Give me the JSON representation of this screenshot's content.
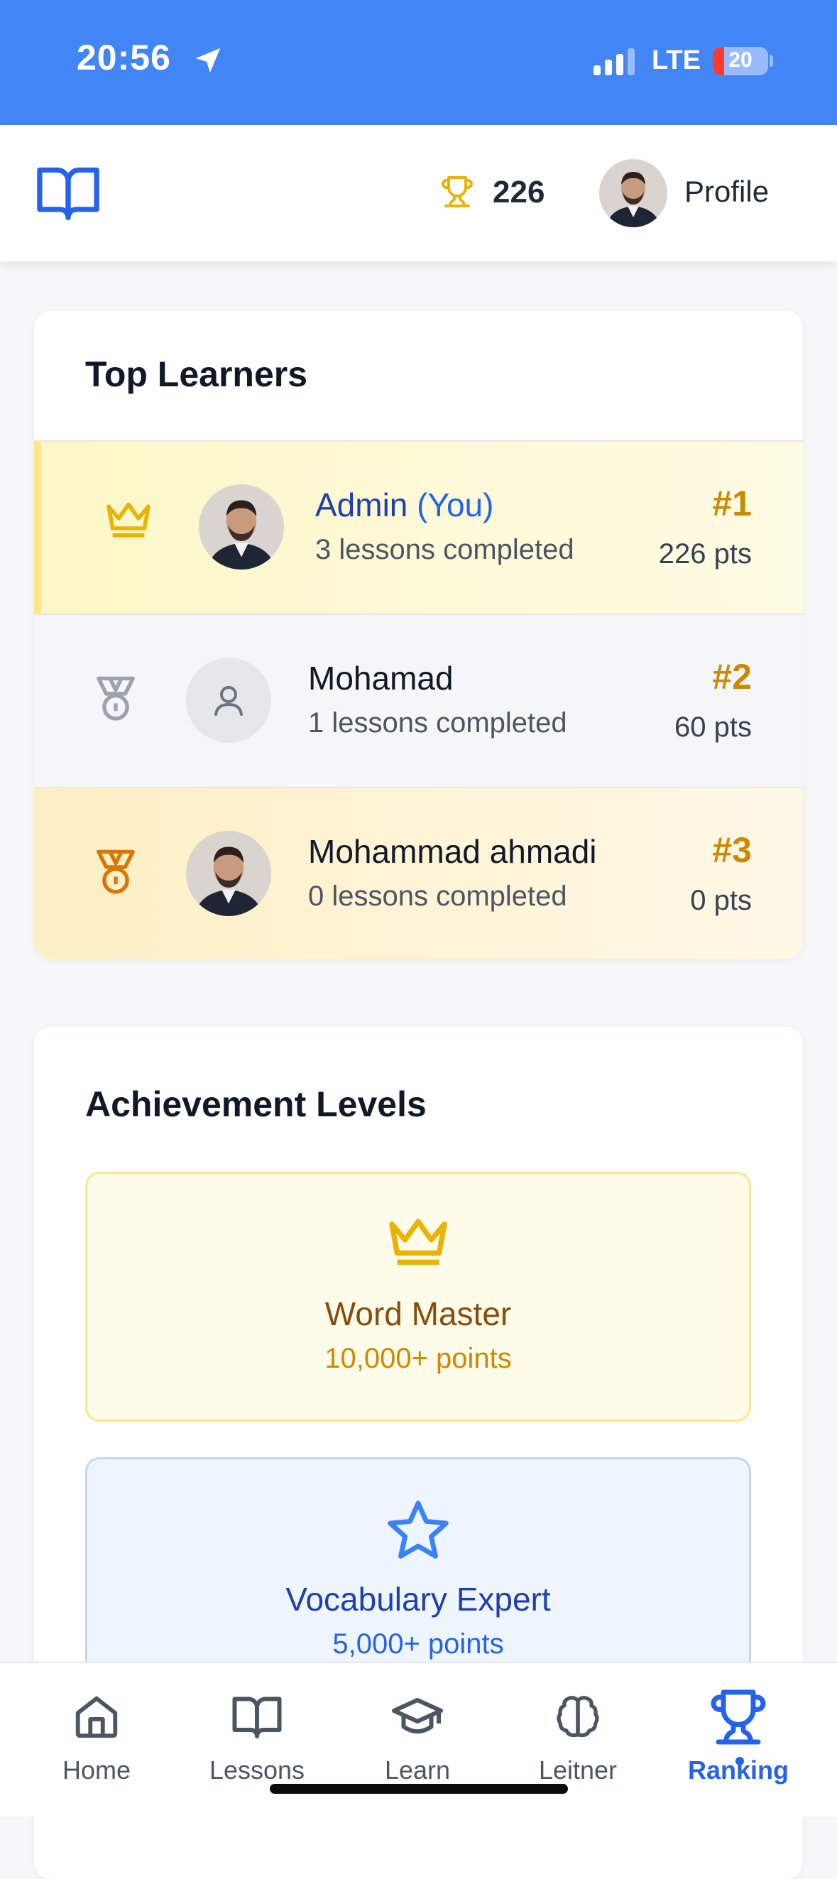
{
  "status_bar": {
    "time": "20:56",
    "network": "LTE",
    "battery": "20"
  },
  "header": {
    "points": "226",
    "profile_label": "Profile"
  },
  "top_learners": {
    "title": "Top Learners",
    "rows": [
      {
        "name": "Admin",
        "you_tag": "(You)",
        "subtitle": "3 lessons completed",
        "rank": "#1",
        "points": "226 pts"
      },
      {
        "name": "Mohamad",
        "you_tag": "",
        "subtitle": "1 lessons completed",
        "rank": "#2",
        "points": "60 pts"
      },
      {
        "name": "Mohammad ahmadi",
        "you_tag": "",
        "subtitle": "0 lessons completed",
        "rank": "#3",
        "points": "0 pts"
      }
    ]
  },
  "achievements": {
    "title": "Achievement Levels",
    "levels": [
      {
        "title": "Word Master",
        "points": "10,000+ points",
        "icon": "crown-icon"
      },
      {
        "title": "Vocabulary Expert",
        "points": "5,000+ points",
        "icon": "star-icon"
      }
    ]
  },
  "nav": {
    "items": [
      {
        "label": "Home",
        "icon": "home-icon"
      },
      {
        "label": "Lessons",
        "icon": "book-icon"
      },
      {
        "label": "Learn",
        "icon": "graduation-cap-icon"
      },
      {
        "label": "Leitner",
        "icon": "brain-icon"
      },
      {
        "label": "Ranking",
        "icon": "trophy-icon"
      }
    ],
    "active": "Ranking"
  },
  "colors": {
    "status_bar": "#4285f4",
    "accent": "#2563eb",
    "gold": "#ca8a04"
  }
}
